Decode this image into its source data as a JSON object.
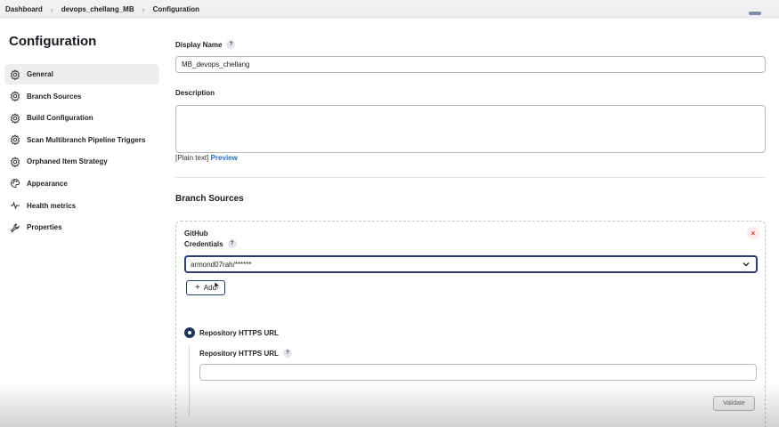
{
  "breadcrumb": [
    "Dashboard",
    "devops_chellang_MB",
    "Configuration"
  ],
  "sidebar": {
    "title": "Configuration",
    "items": [
      {
        "label": "General",
        "icon": "gear-icon",
        "active": true
      },
      {
        "label": "Branch Sources",
        "icon": "gear-icon"
      },
      {
        "label": "Build Configuration",
        "icon": "gear-icon"
      },
      {
        "label": "Scan Multibranch Pipeline Triggers",
        "icon": "gear-icon"
      },
      {
        "label": "Orphaned Item Strategy",
        "icon": "gear-icon"
      },
      {
        "label": "Appearance",
        "icon": "palette-icon"
      },
      {
        "label": "Health metrics",
        "icon": "pulse-icon"
      },
      {
        "label": "Properties",
        "icon": "wrench-icon"
      }
    ]
  },
  "form": {
    "display_name_label": "Display Name",
    "display_name_value": "MB_devops_chellang",
    "description_label": "Description",
    "description_value": "",
    "plain_text": "[Plain text]",
    "preview": "Preview",
    "help": "?"
  },
  "branch_sources": {
    "title": "Branch Sources",
    "source_title": "GitHub",
    "credentials_label": "Credentials",
    "credentials_value": "armond07rah/******",
    "add_label": "Add",
    "radio_label": "Repository HTTPS URL",
    "url_label": "Repository HTTPS URL",
    "url_value": "",
    "validate_label": "Validate",
    "close": "×"
  },
  "colors": {
    "accent": "#2b3e74",
    "link": "#2a6cc6",
    "close": "#d03a3a"
  }
}
